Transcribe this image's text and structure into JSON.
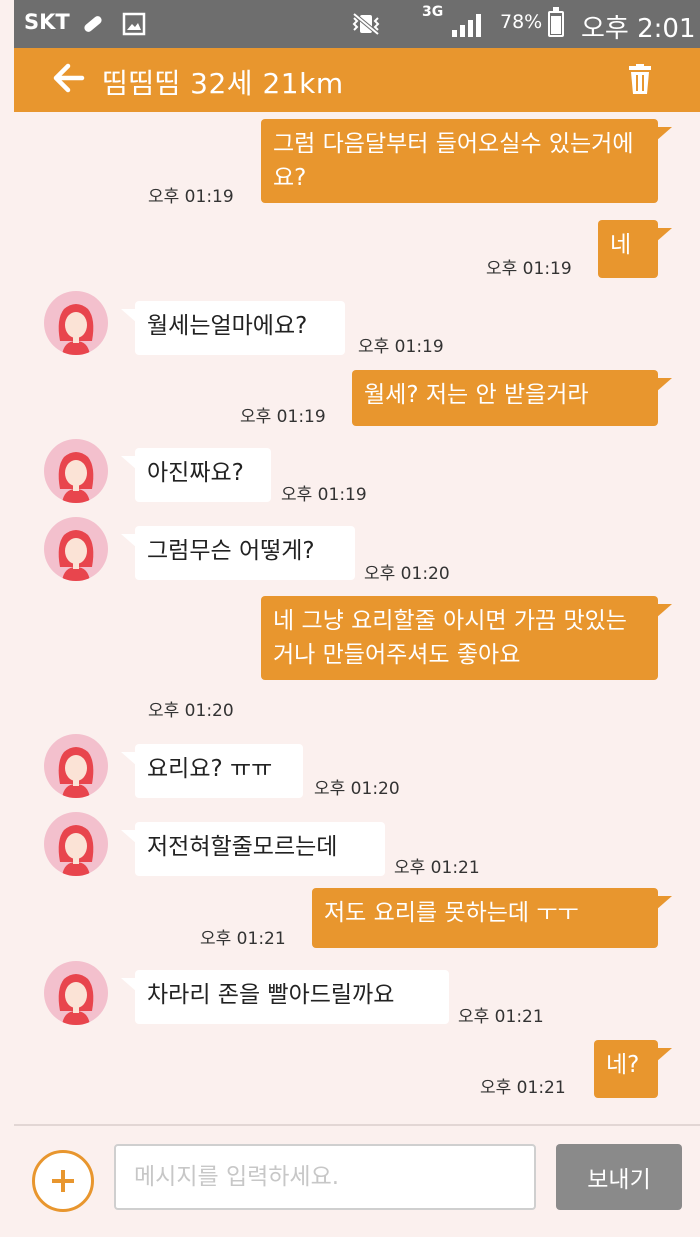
{
  "status_bar": {
    "carrier": "SKT",
    "network": "3G",
    "battery": "78%",
    "time": "오후 2:01"
  },
  "header": {
    "title": "띰띰띰 32세 21km",
    "icons": [
      "back-arrow-icon",
      "trash-icon"
    ]
  },
  "messages": [
    {
      "side": "out",
      "text": "그럼 다음달부터 들어오실수 있는거에요?",
      "time": "오후 01:19"
    },
    {
      "side": "out",
      "text": "네",
      "time": "오후 01:19"
    },
    {
      "side": "in",
      "text": "월세는얼마에요?",
      "time": "오후 01:19"
    },
    {
      "side": "out",
      "text": "월세? 저는 안 받을거라",
      "time": "오후 01:19"
    },
    {
      "side": "in",
      "text": "아진짜요?",
      "time": "오후 01:19"
    },
    {
      "side": "in",
      "text": "그럼무슨 어떻게?",
      "time": "오후 01:20"
    },
    {
      "side": "out",
      "text": "네 그냥 요리할줄 아시면 가끔 맛있는거나 만들어주셔도 좋아요",
      "time": "오후 01:20"
    },
    {
      "side": "in",
      "text": "요리요? ㅠㅠ",
      "time": "오후 01:20"
    },
    {
      "side": "in",
      "text": "저전혀할줄모르는데",
      "time": "오후 01:21"
    },
    {
      "side": "out",
      "text": "저도 요리를 못하는데 ㅜㅜ",
      "time": "오후 01:21"
    },
    {
      "side": "in",
      "text": "차라리 존을 빨아드릴까요",
      "time": "오후 01:21"
    },
    {
      "side": "out",
      "text": "네?",
      "time": "오후 01:21"
    }
  ],
  "composer": {
    "placeholder": "메시지를 입력하세요.",
    "send_label": "보내기"
  },
  "colors": {
    "accent": "#e8962e",
    "background": "#fbf0ee",
    "status_bar": "#6e6e6e",
    "incoming_bubble": "#ffffff",
    "avatar_bg": "#f3c0cd"
  }
}
